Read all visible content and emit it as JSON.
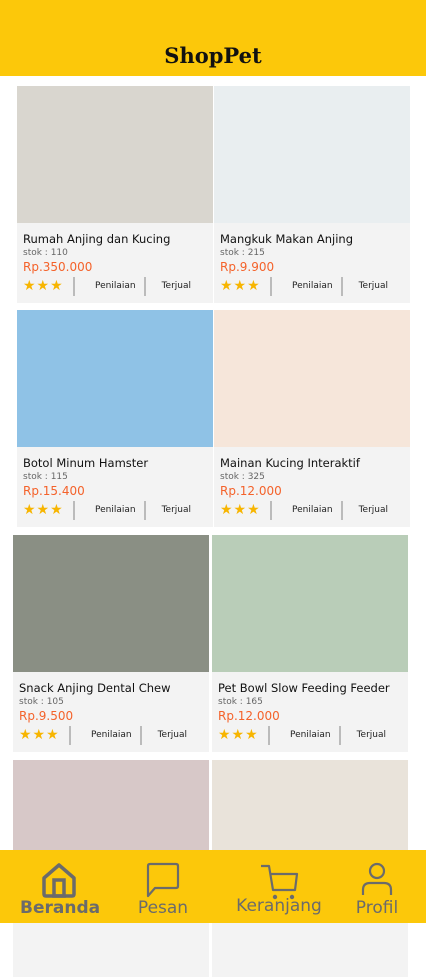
{
  "header": {
    "title": "ShopPet"
  },
  "products": [
    {
      "name": "Rumah Anjing dan Kucing",
      "stok": "stok : 110",
      "price": "Rp.350.000",
      "stars": "★★★",
      "rating_label": "Penilaian",
      "sold_label": "Terjual",
      "img_color": "#d9d6cf"
    },
    {
      "name": "Mangkuk Makan Anjing",
      "stok": "stok : 215",
      "price": "Rp.9.900",
      "stars": "★★★",
      "rating_label": "Penilaian",
      "sold_label": "Terjual",
      "img_color": "#e9eef0"
    },
    {
      "name": "Botol Minum Hamster",
      "stok": "stok : 115",
      "price": "Rp.15.400",
      "stars": "★★★",
      "rating_label": "Penilaian",
      "sold_label": "Terjual",
      "img_color": "#8fc2e6"
    },
    {
      "name": "Mainan Kucing Interaktif",
      "stok": "stok : 325",
      "price": "Rp.12.000",
      "stars": "★★★",
      "rating_label": "Penilaian",
      "sold_label": "Terjual",
      "img_color": "#f6e6da"
    },
    {
      "name": "Snack Anjing Dental Chew",
      "stok": "stok : 105",
      "price": "Rp.9.500",
      "stars": "★★★",
      "rating_label": "Penilaian",
      "sold_label": "Terjual",
      "img_color": "#8a8f84"
    },
    {
      "name": "Pet Bowl Slow Feeding Feeder",
      "stok": "stok : 165",
      "price": "Rp.12.000",
      "stars": "★★★",
      "rating_label": "Penilaian",
      "sold_label": "Terjual",
      "img_color": "#b9cdb8"
    },
    {
      "img_color": "#d7c8c8"
    },
    {
      "img_color": "#e9e3da"
    }
  ],
  "nav": {
    "items": [
      {
        "label": "Beranda",
        "icon": "home-icon"
      },
      {
        "label": "Pesan",
        "icon": "chat-icon"
      },
      {
        "label": "Keranjang",
        "icon": "cart-icon"
      },
      {
        "label": "Profil",
        "icon": "user-icon"
      }
    ],
    "color": "#fcc80a",
    "active": "Beranda"
  }
}
